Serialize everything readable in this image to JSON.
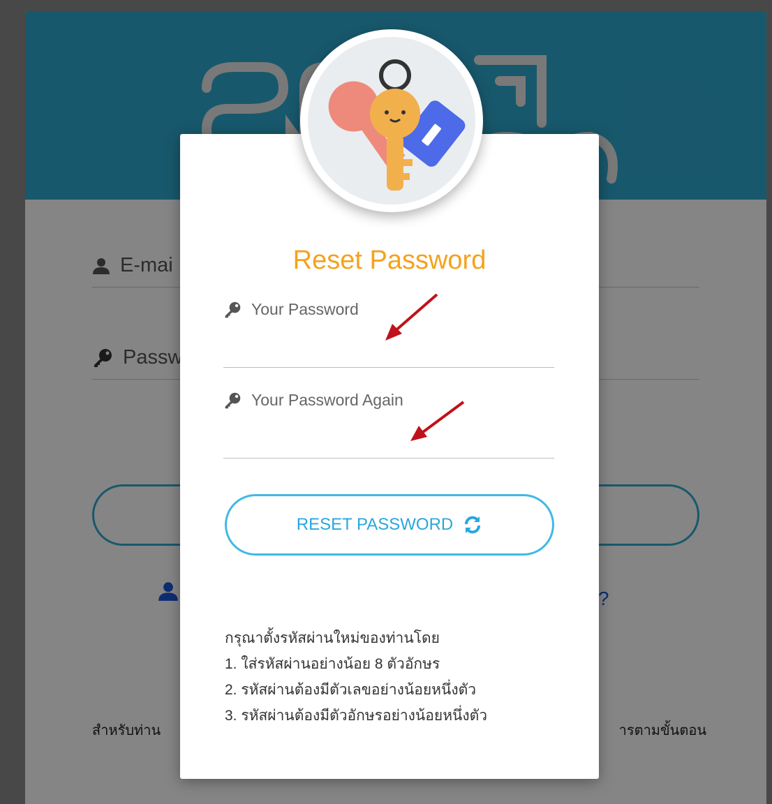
{
  "background": {
    "logo_text": "สวน NOO",
    "email_placeholder": "E-mai",
    "password_placeholder": "Passw",
    "forgot_link": "rd?",
    "bottom_note_left": "สำหรับท่าน",
    "bottom_note_right": "ารตามขั้นตอน"
  },
  "modal": {
    "title": "Reset Password",
    "password_label": "Your Password",
    "password_again_label": "Your Password Again",
    "button_label": "RESET PASSWORD",
    "instructions": [
      "กรุณาตั้งรหัสผ่านใหม่ของท่านโดย",
      "1. ใส่รหัสผ่านอย่างน้อย 8 ตัวอักษร",
      "2. รหัสผ่านต้องมีตัวเลขอย่างน้อยหนึ่งตัว",
      "3. รหัสผ่านต้องมีตัวอักษรอย่างน้อยหนึ่งตัว"
    ]
  },
  "colors": {
    "header": "#2fa9cf",
    "title": "#f5a21c",
    "button": "#41b8e4",
    "link": "#1a56db",
    "arrow": "#c0121a"
  },
  "icons": [
    "user-icon",
    "key-icon",
    "refresh-icon",
    "keys-illustration"
  ]
}
